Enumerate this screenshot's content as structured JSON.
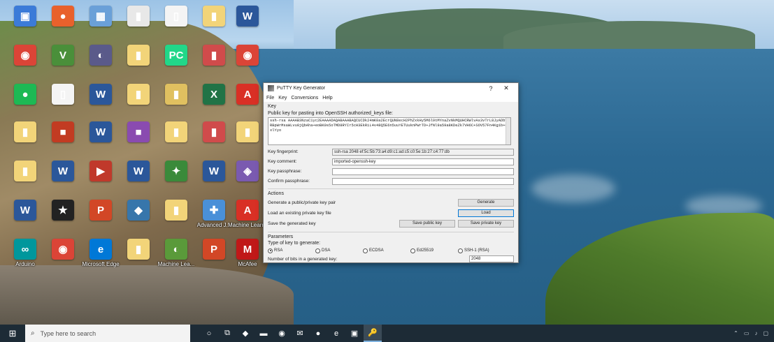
{
  "desktop": {
    "icons": [
      {
        "label": "",
        "glyph": "▣",
        "color": "#3b7bd8",
        "icon": "recycle-bin-icon"
      },
      {
        "label": "",
        "glyph": "●",
        "color": "#e8612c",
        "icon": "firefox-icon"
      },
      {
        "label": "",
        "glyph": "▦",
        "color": "#6aa0d8",
        "icon": "app-icon"
      },
      {
        "label": "",
        "glyph": "▮",
        "color": "#e8e8e8",
        "icon": "file-icon"
      },
      {
        "label": "",
        "glyph": "▯",
        "color": "#f4f4f4",
        "icon": "file-icon"
      },
      {
        "label": "",
        "glyph": "▮",
        "color": "#f2d479",
        "icon": "folder-icon"
      },
      {
        "label": "",
        "glyph": "W",
        "color": "#2b579a",
        "icon": "word-icon"
      },
      {
        "label": "",
        "glyph": "◉",
        "color": "#db4437",
        "icon": "chrome-icon"
      },
      {
        "label": "",
        "glyph": "V",
        "color": "#4a8f3a",
        "icon": "vim-icon"
      },
      {
        "label": "",
        "glyph": "◐",
        "color": "#5a5a8a",
        "icon": "eclipse-icon"
      },
      {
        "label": "",
        "glyph": "▮",
        "color": "#f2d479",
        "icon": "folder-icon"
      },
      {
        "label": "",
        "glyph": "PC",
        "color": "#21d789",
        "icon": "pycharm-icon"
      },
      {
        "label": "",
        "glyph": "▮",
        "color": "#d04b4b",
        "icon": "app-icon"
      },
      {
        "label": "",
        "glyph": "◉",
        "color": "#db4437",
        "icon": "chrome-icon"
      },
      {
        "label": "",
        "glyph": "●",
        "color": "#1db954",
        "icon": "spotify-icon"
      },
      {
        "label": "",
        "glyph": "▯",
        "color": "#f4f4f4",
        "icon": "file-icon"
      },
      {
        "label": "",
        "glyph": "W",
        "color": "#2b579a",
        "icon": "word-icon"
      },
      {
        "label": "",
        "glyph": "▮",
        "color": "#f2d479",
        "icon": "folder-icon"
      },
      {
        "label": "",
        "glyph": "▮",
        "color": "#e0c060",
        "icon": "folder-icon"
      },
      {
        "label": "",
        "glyph": "X",
        "color": "#217346",
        "icon": "excel-icon"
      },
      {
        "label": "",
        "glyph": "A",
        "color": "#d93025",
        "icon": "acrobat-icon"
      },
      {
        "label": "",
        "glyph": "▮",
        "color": "#f2d479",
        "icon": "folder-icon"
      },
      {
        "label": "",
        "glyph": "■",
        "color": "#c23b22",
        "icon": "app-icon"
      },
      {
        "label": "",
        "glyph": "W",
        "color": "#2b579a",
        "icon": "word-icon"
      },
      {
        "label": "",
        "glyph": "■",
        "color": "#8a4bb0",
        "icon": "app-icon"
      },
      {
        "label": "",
        "glyph": "▮",
        "color": "#f2d479",
        "icon": "folder-icon"
      },
      {
        "label": "",
        "glyph": "▮",
        "color": "#d04b4b",
        "icon": "app-icon"
      },
      {
        "label": "",
        "glyph": "▮",
        "color": "#f2d479",
        "icon": "folder-icon"
      },
      {
        "label": "",
        "glyph": "▮",
        "color": "#f2d479",
        "icon": "folder-icon"
      },
      {
        "label": "",
        "glyph": "W",
        "color": "#2b579a",
        "icon": "word-icon"
      },
      {
        "label": "",
        "glyph": "▶",
        "color": "#c0392b",
        "icon": "app-icon"
      },
      {
        "label": "",
        "glyph": "W",
        "color": "#2b579a",
        "icon": "word-icon"
      },
      {
        "label": "",
        "glyph": "✦",
        "color": "#3a8a3a",
        "icon": "app-icon"
      },
      {
        "label": "",
        "glyph": "W",
        "color": "#2b579a",
        "icon": "word-icon"
      },
      {
        "label": "",
        "glyph": "◈",
        "color": "#7a5ab0",
        "icon": "app-icon"
      },
      {
        "label": "",
        "glyph": "W",
        "color": "#2b579a",
        "icon": "word-icon"
      },
      {
        "label": "",
        "glyph": "★",
        "color": "#222222",
        "icon": "movie-icon"
      },
      {
        "label": "",
        "glyph": "P",
        "color": "#d24726",
        "icon": "powerpoint-icon"
      },
      {
        "label": "",
        "glyph": "◆",
        "color": "#3776ab",
        "icon": "python-icon"
      },
      {
        "label": "",
        "glyph": "▮",
        "color": "#f2d479",
        "icon": "folder-icon"
      },
      {
        "label": "Advanced J...",
        "glyph": "✚",
        "color": "#4a90d8",
        "icon": "app-icon"
      },
      {
        "label": "Machine Learnin...",
        "glyph": "A",
        "color": "#d93025",
        "icon": "acrobat-icon"
      },
      {
        "label": "Arduino",
        "glyph": "∞",
        "color": "#00979c",
        "icon": "arduino-icon"
      },
      {
        "label": "",
        "glyph": "◉",
        "color": "#db4437",
        "icon": "chrome-icon"
      },
      {
        "label": "Microsoft Edge",
        "glyph": "e",
        "color": "#0078d7",
        "icon": "edge-icon"
      },
      {
        "label": "",
        "glyph": "▮",
        "color": "#f2d479",
        "icon": "folder-icon"
      },
      {
        "label": "Machine Lea...",
        "glyph": "◐",
        "color": "#5a9a3a",
        "icon": "app-icon"
      },
      {
        "label": "",
        "glyph": "P",
        "color": "#d24726",
        "icon": "powerpoint-icon"
      },
      {
        "label": "McAfee",
        "glyph": "M",
        "color": "#c01818",
        "icon": "mcafee-icon"
      }
    ]
  },
  "putty": {
    "title": "PuTTY Key Generator",
    "help_btn": "?",
    "close_btn": "✕",
    "menu": [
      "File",
      "Key",
      "Conversions",
      "Help"
    ],
    "key_group": "Key",
    "pubkey_label": "Public key for pasting into OpenSSH authorized_keys file:",
    "pubkey_text": "ssh-rsa AAAAB3NzaC1yc2EAAAADAQABAAABAQCUCDk24mK0a2EcrQUN8ecH2PhZxkHy5M6l9tMYnaZvNkMQUHCRWlvAs3vTrL8JyADbYRBpWrMsaWLvu0jQbAha+eoBK0s5oTMD8RYIr5cH3EkRiL4v48Q5E6n5uuYETUuknPWrTD+JfNl9a59a8KDeZk7VH6C+SOV57Fn4Kg1b+8xlYyo",
    "fingerprint_label": "Key fingerprint:",
    "fingerprint_value": "ssh-rsa 2048 ef:5c:5b:73:a4:d9:c1:ad:c5:c0:5e:1b:27:c4:77:db",
    "comment_label": "Key comment:",
    "comment_value": "imported-openssh-key",
    "passphrase_label": "Key passphrase:",
    "passphrase_value": "",
    "confirm_label": "Confirm passphrase:",
    "confirm_value": "",
    "actions_group": "Actions",
    "generate_label": "Generate a public/private key pair",
    "generate_btn": "Generate",
    "load_label": "Load an existing private key file",
    "load_btn": "Load",
    "save_label": "Save the generated key",
    "save_public_btn": "Save public key",
    "save_private_btn": "Save private key",
    "params_group": "Parameters",
    "type_label": "Type of key to generate:",
    "key_types": [
      "RSA",
      "DSA",
      "ECDSA",
      "Ed25519",
      "SSH-1 (RSA)"
    ],
    "selected_type": "RSA",
    "bits_label": "Number of bits in a generated key:",
    "bits_value": "2048"
  },
  "taskbar": {
    "start_glyph": "⊞",
    "search_placeholder": "Type here to search",
    "search_glyph": "⌕",
    "apps": [
      {
        "glyph": "○",
        "icon": "cortana-icon"
      },
      {
        "glyph": "⧉",
        "icon": "task-view-icon"
      },
      {
        "glyph": "◆",
        "icon": "python-icon"
      },
      {
        "glyph": "▬",
        "icon": "file-explorer-icon"
      },
      {
        "glyph": "◉",
        "icon": "chrome-icon"
      },
      {
        "glyph": "✉",
        "icon": "mail-icon"
      },
      {
        "glyph": "●",
        "icon": "firefox-icon"
      },
      {
        "glyph": "e",
        "icon": "edge-icon"
      },
      {
        "glyph": "▣",
        "icon": "store-icon"
      },
      {
        "glyph": "🔑",
        "icon": "putty-keygen-icon"
      }
    ],
    "tray_glyphs": [
      "⌃",
      "▭",
      "♪"
    ],
    "notification_glyph": "▢"
  }
}
